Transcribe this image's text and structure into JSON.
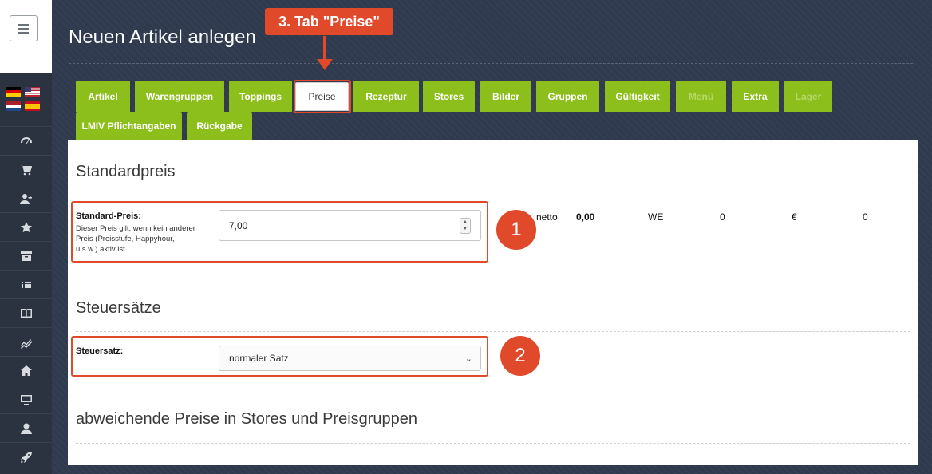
{
  "page_title": "Neuen Artikel anlegen",
  "annotation": {
    "step_label": "3. Tab \"Preise\"",
    "badge_1": "1",
    "badge_2": "2"
  },
  "tabs": [
    {
      "label": "Artikel"
    },
    {
      "label": "Warengruppen"
    },
    {
      "label": "Toppings"
    },
    {
      "label": "Preise"
    },
    {
      "label": "Rezeptur"
    },
    {
      "label": "Stores"
    },
    {
      "label": "Bilder"
    },
    {
      "label": "Gruppen"
    },
    {
      "label": "Gültigkeit"
    },
    {
      "label": "Menü"
    },
    {
      "label": "Extra"
    },
    {
      "label": "Lager"
    },
    {
      "label": "LMIV Pflichtangaben"
    },
    {
      "label": "Rückgabe"
    }
  ],
  "standardpreis": {
    "heading": "Standardpreis",
    "label": "Standard-Preis:",
    "help": "Dieser Preis gilt, wenn kein anderer Preis (Preisstufe, Happyhour, u.s.w.) aktiv ist.",
    "value": "7,00",
    "netto_label": "netto",
    "netto_value": "0,00",
    "unit": "WE",
    "col_a": "0",
    "currency": "€",
    "col_b": "0"
  },
  "steuersaetze": {
    "heading": "Steuersätze",
    "label": "Steuersatz:",
    "selected": "normaler Satz"
  },
  "abweichende": {
    "heading": "abweichende Preise in Stores und Preisgruppen"
  },
  "colors": {
    "accent_green": "#8cbf1b",
    "annotation_red": "#e0492a",
    "background": "#2f3a4f"
  },
  "sidebar_icons": [
    "dashboard-icon",
    "cart-icon",
    "add-user-icon",
    "star-icon",
    "archive-icon",
    "list-icon",
    "book-icon",
    "chart-icon",
    "home-icon",
    "monitor-icon",
    "user-icon",
    "rocket-icon"
  ]
}
